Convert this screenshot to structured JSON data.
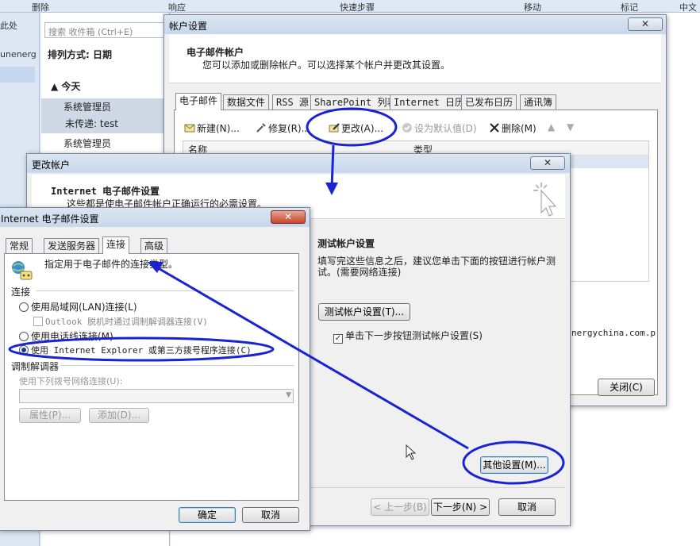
{
  "outlook": {
    "ribbon": [
      "删除",
      "响应",
      "快速步骤",
      "移动",
      "标记",
      "中文"
    ],
    "nav": [
      "此处",
      "unenerg"
    ],
    "search_placeholder": "搜索 收件箱 (Ctrl+E)",
    "sort_label": "排列方式: 日期",
    "group_today": "今天",
    "items": [
      {
        "sender": "系统管理员",
        "sub": "未传递: test"
      },
      {
        "sender": "系统管理员"
      }
    ]
  },
  "account_settings": {
    "title": "帐户设置",
    "close": "✕",
    "heading": "电子邮件帐户",
    "desc": "您可以添加或删除帐户。可以选择某个帐户并更改其设置。",
    "tabs": [
      "电子邮件",
      "数据文件",
      "RSS 源",
      "SharePoint 列表",
      "Internet 日历",
      "已发布日历",
      "通讯簿"
    ],
    "toolbar": {
      "new": "新建(N)...",
      "repair": "修复(R)...",
      "change": "更改(A)...",
      "default": "设为默认值(D)",
      "remove": "删除(M)"
    },
    "columns": {
      "name": "名称",
      "type": "类型"
    },
    "account_suffix": "nergychina.com.p",
    "close_button": "关闭(C)"
  },
  "change_account": {
    "title": "更改帐户",
    "close": "✕",
    "heading": "Internet 电子邮件设置",
    "desc": "这些都是使电子邮件帐户正确运行的必需设置。",
    "test_heading": "测试帐户设置",
    "test_desc": "填写完这些信息之后，建议您单击下面的按钮进行帐户测试。(需要网络连接)",
    "test_button": "测试帐户设置(T)...",
    "test_checkbox": "单击下一步按钮测试帐户设置(S)",
    "more_settings": "其他设置(M)...",
    "back": "< 上一步(B)",
    "next": "下一步(N) >",
    "cancel": "取消"
  },
  "internet_settings": {
    "title": "Internet 电子邮件设置",
    "close": "✕",
    "tabs": [
      "常规",
      "发送服务器",
      "连接",
      "高级"
    ],
    "intro": "指定用于电子邮件的连接类型。",
    "group_connection": "连接",
    "opt_lan": "使用局域网(LAN)连接(L)",
    "opt_offline": "Outlook 脱机时通过调制解调器连接(V)",
    "opt_phone": "使用电话线连接(M)",
    "opt_ie": "使用 Internet Explorer 或第三方拨号程序连接(C)",
    "group_modem": "调制解调器",
    "dial_label": "使用下列拨号网络连接(U):",
    "properties": "属性(P)...",
    "add": "添加(D)...",
    "ok": "确定",
    "cancel": "取消"
  },
  "colors": {
    "annotation": "#1a23d4",
    "titlebar": "#c8d7ea"
  }
}
